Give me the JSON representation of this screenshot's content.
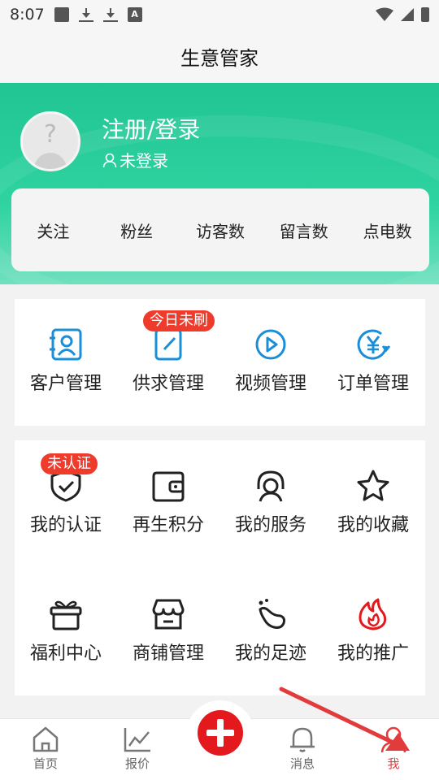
{
  "status_bar": {
    "time": "8:07"
  },
  "page_title": "生意管家",
  "profile": {
    "login_title": "注册/登录",
    "login_status": "未登录"
  },
  "stats": [
    "关注",
    "粉丝",
    "访客数",
    "留言数",
    "点电数"
  ],
  "card1": {
    "items": [
      {
        "label": "客户管理",
        "icon": "customer-icon"
      },
      {
        "label": "供求管理",
        "icon": "supply-edit-icon",
        "badge": "今日未刷"
      },
      {
        "label": "视频管理",
        "icon": "video-play-icon"
      },
      {
        "label": "订单管理",
        "icon": "yuan-order-icon"
      }
    ]
  },
  "card2": {
    "items": [
      {
        "label": "我的认证",
        "icon": "shield-check-icon",
        "badge": "未认证"
      },
      {
        "label": "再生积分",
        "icon": "wallet-icon"
      },
      {
        "label": "我的服务",
        "icon": "headset-icon"
      },
      {
        "label": "我的收藏",
        "icon": "star-icon"
      },
      {
        "label": "福利中心",
        "icon": "gift-icon"
      },
      {
        "label": "商铺管理",
        "icon": "shop-icon"
      },
      {
        "label": "我的足迹",
        "icon": "footprint-icon"
      },
      {
        "label": "我的推广",
        "icon": "flame-icon"
      }
    ]
  },
  "tabbar": {
    "home": "首页",
    "quote": "报价",
    "messages": "消息",
    "me": "我"
  },
  "colors": {
    "accent_green": "#21c593",
    "icon_blue": "#1a8fd8",
    "active_red": "#e83a3a",
    "badge_red": "#ef3b2c",
    "post_red": "#e3191e"
  }
}
